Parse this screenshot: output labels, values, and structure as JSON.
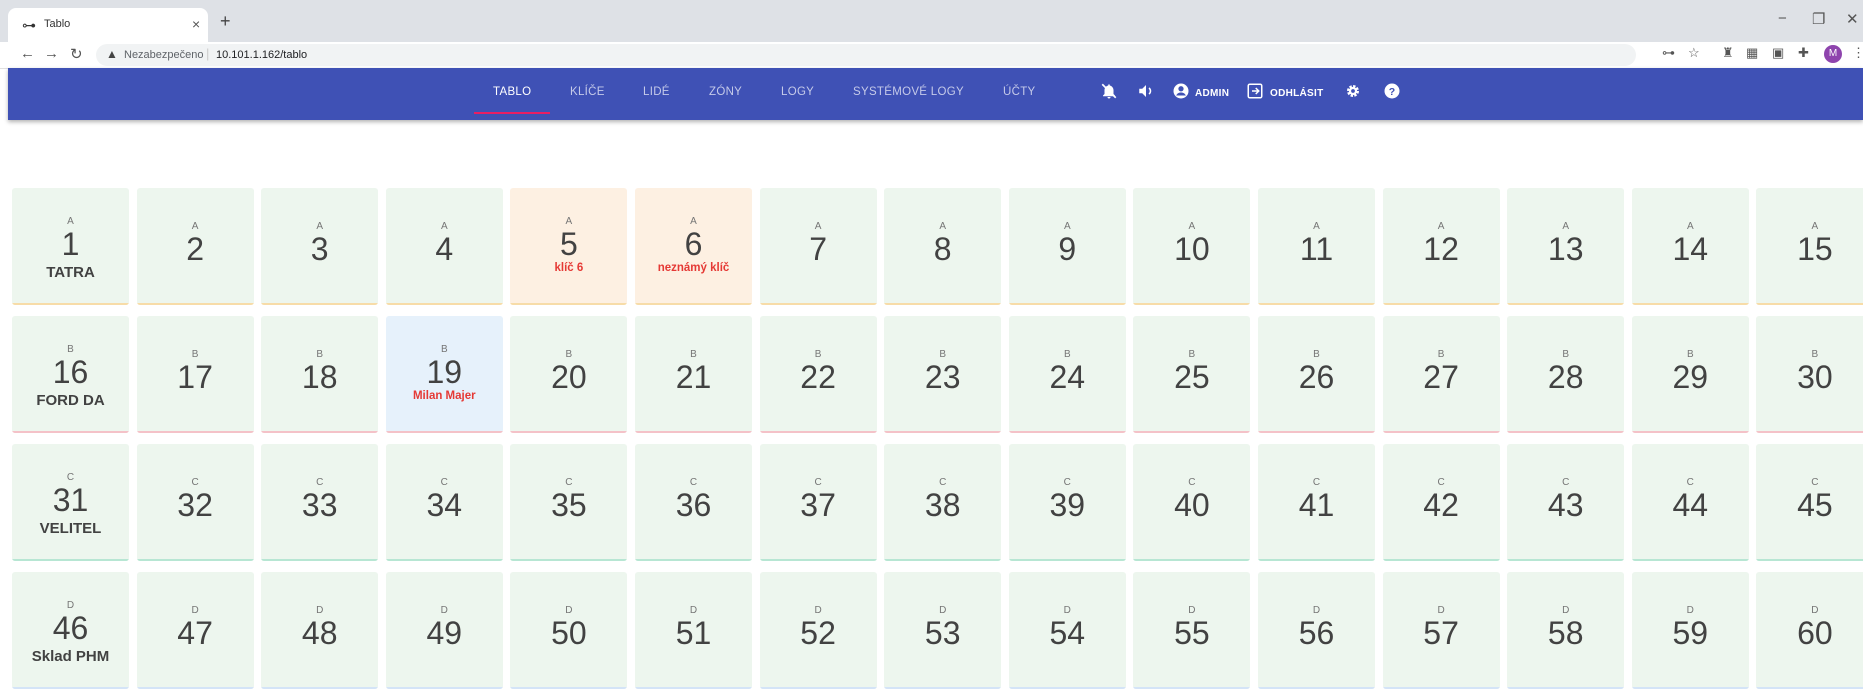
{
  "browser": {
    "tab_title": "Tablo",
    "tab_icon": "key-icon",
    "security_text": "Nezabezpečeno",
    "url": "10.101.1.162/tablo",
    "avatar_letter": "M"
  },
  "nav": {
    "tabs": [
      {
        "label": "TABLO",
        "active": true
      },
      {
        "label": "KLÍČE",
        "active": false
      },
      {
        "label": "LIDÉ",
        "active": false
      },
      {
        "label": "ZÓNY",
        "active": false
      },
      {
        "label": "LOGY",
        "active": false
      },
      {
        "label": "SYSTÉMOVÉ LOGY",
        "active": false
      },
      {
        "label": "ÚČTY",
        "active": false
      }
    ],
    "user_label": "ADMIN",
    "logout_label": "ODHLÁSIT"
  },
  "colors": {
    "appbar": "#3f51b5",
    "active_indicator": "#e91e63",
    "card_ok": "#edf6ee",
    "card_warning": "#fdf0e2",
    "card_person": "#e6f1fb",
    "alert_text": "#e53935",
    "zone_A_bar": "#f7dca8",
    "zone_B_bar": "#f4c2c8",
    "zone_C_bar": "#b7e6d3",
    "zone_D_bar": "#d4e4f7"
  },
  "rows": [
    {
      "zone": "A",
      "label": "TATRA",
      "slots": [
        {
          "number": "1"
        },
        {
          "number": "2"
        },
        {
          "number": "3"
        },
        {
          "number": "4"
        },
        {
          "number": "5",
          "status": "warning",
          "note": "klíč 6"
        },
        {
          "number": "6",
          "status": "warning",
          "note": "neznámý klíč"
        },
        {
          "number": "7"
        },
        {
          "number": "8"
        },
        {
          "number": "9"
        },
        {
          "number": "10"
        },
        {
          "number": "11"
        },
        {
          "number": "12"
        },
        {
          "number": "13"
        },
        {
          "number": "14"
        },
        {
          "number": "15"
        }
      ]
    },
    {
      "zone": "B",
      "label": "FORD DA",
      "slots": [
        {
          "number": "16"
        },
        {
          "number": "17"
        },
        {
          "number": "18"
        },
        {
          "number": "19",
          "status": "person",
          "note": "Milan Majer"
        },
        {
          "number": "20"
        },
        {
          "number": "21"
        },
        {
          "number": "22"
        },
        {
          "number": "23"
        },
        {
          "number": "24"
        },
        {
          "number": "25"
        },
        {
          "number": "26"
        },
        {
          "number": "27"
        },
        {
          "number": "28"
        },
        {
          "number": "29"
        },
        {
          "number": "30"
        }
      ]
    },
    {
      "zone": "C",
      "label": "VELITEL",
      "slots": [
        {
          "number": "31"
        },
        {
          "number": "32"
        },
        {
          "number": "33"
        },
        {
          "number": "34"
        },
        {
          "number": "35"
        },
        {
          "number": "36"
        },
        {
          "number": "37"
        },
        {
          "number": "38"
        },
        {
          "number": "39"
        },
        {
          "number": "40"
        },
        {
          "number": "41"
        },
        {
          "number": "42"
        },
        {
          "number": "43"
        },
        {
          "number": "44"
        },
        {
          "number": "45"
        }
      ]
    },
    {
      "zone": "D",
      "label": "Sklad PHM",
      "slots": [
        {
          "number": "46"
        },
        {
          "number": "47"
        },
        {
          "number": "48"
        },
        {
          "number": "49"
        },
        {
          "number": "50"
        },
        {
          "number": "51"
        },
        {
          "number": "52"
        },
        {
          "number": "53"
        },
        {
          "number": "54"
        },
        {
          "number": "55"
        },
        {
          "number": "56"
        },
        {
          "number": "57"
        },
        {
          "number": "58"
        },
        {
          "number": "59"
        },
        {
          "number": "60"
        }
      ]
    }
  ]
}
